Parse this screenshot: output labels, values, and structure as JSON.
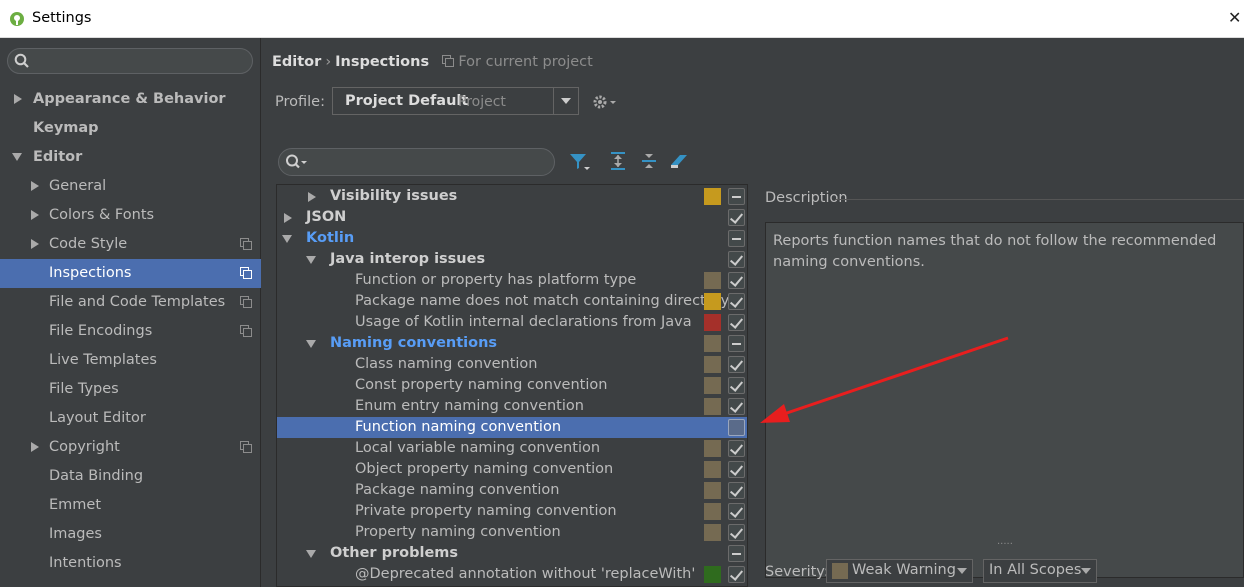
{
  "window": {
    "title": "Settings",
    "close_glyph": "✕"
  },
  "sidebar": {
    "search_placeholder": "",
    "items": [
      {
        "label": "Appearance & Behavior"
      },
      {
        "label": "Keymap"
      },
      {
        "label": "Editor"
      },
      {
        "label": "General"
      },
      {
        "label": "Colors & Fonts"
      },
      {
        "label": "Code Style"
      },
      {
        "label": "Inspections"
      },
      {
        "label": "File and Code Templates"
      },
      {
        "label": "File Encodings"
      },
      {
        "label": "Live Templates"
      },
      {
        "label": "File Types"
      },
      {
        "label": "Layout Editor"
      },
      {
        "label": "Copyright"
      },
      {
        "label": "Data Binding"
      },
      {
        "label": "Emmet"
      },
      {
        "label": "Images"
      },
      {
        "label": "Intentions"
      }
    ]
  },
  "header": {
    "crumb_editor": "Editor",
    "crumb_sep": "›",
    "crumb_inspections": "Inspections",
    "crumb_note": "For current project"
  },
  "profile": {
    "label": "Profile:",
    "value": "Project Default",
    "sub": "Project"
  },
  "colors": {
    "accent_selected": "#4b6eaf",
    "warning": "#c69a1e",
    "error": "#a5302a",
    "weak_warning": "#756a52",
    "info": "#2f6b1e",
    "link_blue": "#589df6"
  },
  "tree": {
    "rows": [
      {
        "label": "Visibility issues"
      },
      {
        "label": "JSON"
      },
      {
        "label": "Kotlin"
      },
      {
        "label": "Java interop issues"
      },
      {
        "label": "Function or property has platform type"
      },
      {
        "label": "Package name does not match containing directory"
      },
      {
        "label": "Usage of Kotlin internal declarations from Java"
      },
      {
        "label": "Naming conventions"
      },
      {
        "label": "Class naming convention"
      },
      {
        "label": "Const property naming convention"
      },
      {
        "label": "Enum entry naming convention"
      },
      {
        "label": "Function naming convention"
      },
      {
        "label": "Local variable naming convention"
      },
      {
        "label": "Object property naming convention"
      },
      {
        "label": "Package naming convention"
      },
      {
        "label": "Private property naming convention"
      },
      {
        "label": "Property naming convention"
      },
      {
        "label": "Other problems"
      },
      {
        "label": "@Deprecated annotation without 'replaceWith' argu"
      }
    ]
  },
  "description": {
    "label": "Description",
    "text": "Reports function names that do not follow the recommended naming conventions."
  },
  "severity": {
    "label": "Severity:",
    "value": "Weak Warning",
    "scope": "In All Scopes"
  },
  "grip": "....."
}
